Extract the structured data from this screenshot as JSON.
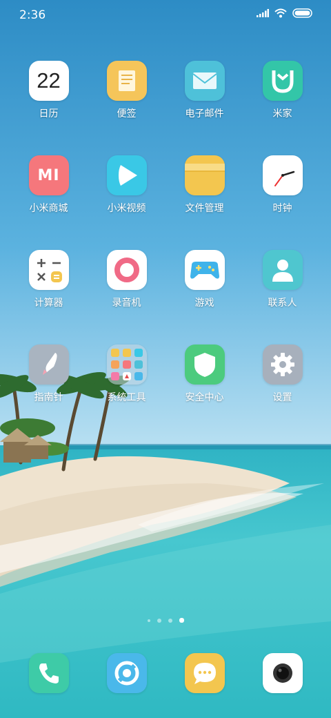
{
  "status_bar": {
    "time": "2:36",
    "icons": [
      "signal-icon",
      "wifi-icon",
      "battery-icon"
    ]
  },
  "apps": [
    {
      "label": "日历",
      "icon": "calendar-icon",
      "icon_text": "22"
    },
    {
      "label": "便签",
      "icon": "notes-icon"
    },
    {
      "label": "电子邮件",
      "icon": "email-icon"
    },
    {
      "label": "米家",
      "icon": "mijia-icon"
    },
    {
      "label": "小米商城",
      "icon": "mi-store-icon",
      "icon_text": "MI"
    },
    {
      "label": "小米视频",
      "icon": "video-play-icon"
    },
    {
      "label": "文件管理",
      "icon": "folder-icon"
    },
    {
      "label": "时钟",
      "icon": "clock-icon"
    },
    {
      "label": "计算器",
      "icon": "calculator-icon"
    },
    {
      "label": "录音机",
      "icon": "recorder-icon"
    },
    {
      "label": "游戏",
      "icon": "gamepad-icon"
    },
    {
      "label": "联系人",
      "icon": "contacts-icon"
    },
    {
      "label": "指南针",
      "icon": "compass-icon"
    },
    {
      "label": "系统工具",
      "icon": "folder-system-tools-icon"
    },
    {
      "label": "安全中心",
      "icon": "shield-icon"
    },
    {
      "label": "设置",
      "icon": "gear-icon"
    }
  ],
  "page_indicator": {
    "count": 4,
    "active_index": 3
  },
  "dock": [
    {
      "icon": "phone-icon"
    },
    {
      "icon": "browser-icon"
    },
    {
      "icon": "messages-icon"
    },
    {
      "icon": "camera-icon"
    }
  ],
  "colors": {
    "calendar_bg": "#ffffff",
    "notes_bg": "#f5c55a",
    "email_bg": "#4ec1d9",
    "mijia_bg": "#33c6a8",
    "mi_store_bg": "#f5777c",
    "video_bg": "#3ac8e6",
    "folder_bg": "#f3c64f",
    "clock_bg": "#ffffff",
    "calculator_bg": "#ffffff",
    "recorder_bg": "#ffffff",
    "game_bg": "#ffffff",
    "contacts_bg": "#4fc6cf",
    "compass_bg": "#a9b4c0",
    "security_bg": "#4ccb7e",
    "settings_bg": "#a7b0bc",
    "phone_bg": "#3ecba7",
    "browser_bg": "#4ab8ea",
    "messages_bg": "#f3c64f",
    "camera_bg": "#ffffff"
  }
}
